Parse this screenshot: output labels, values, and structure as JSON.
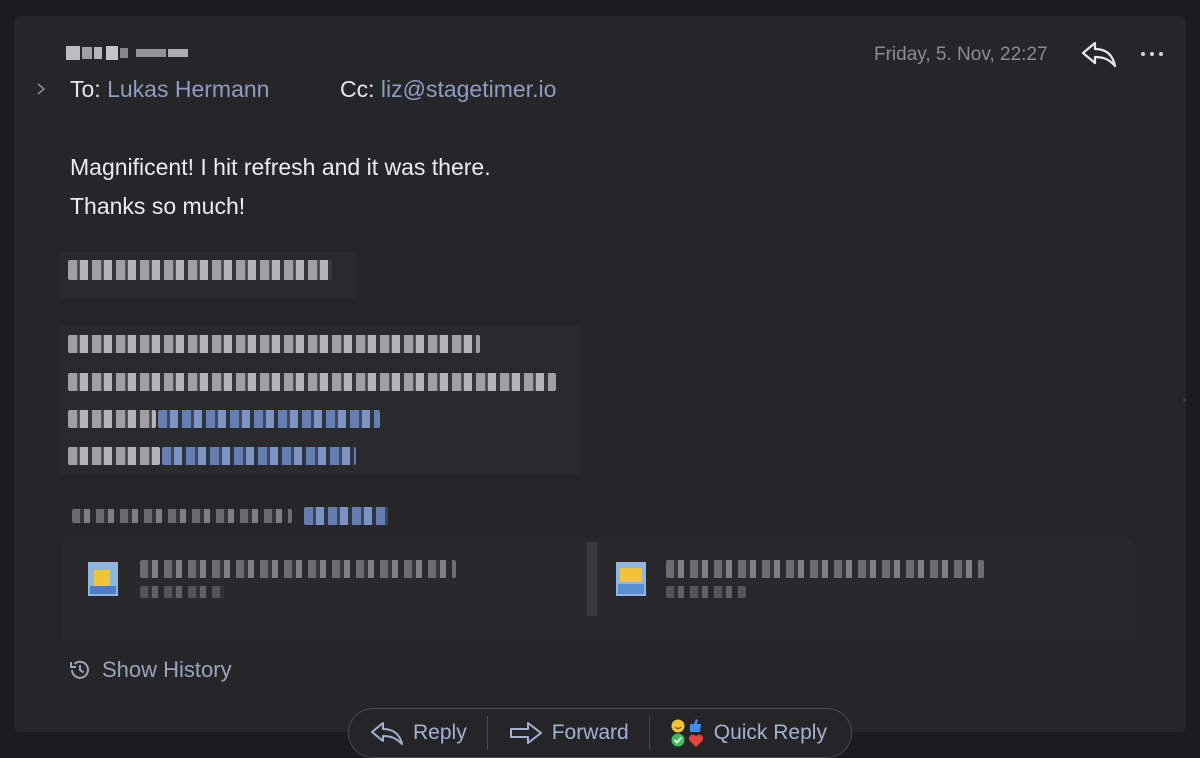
{
  "message": {
    "date": "Friday, 5. Nov, 22:27",
    "to_label": "To:",
    "to_name": "Lukas Hermann",
    "cc_label": "Cc:",
    "cc_address": "liz@stagetimer.io",
    "body_line1": "Magnificent! I hit refresh and it was there.",
    "body_line2": "Thanks so much!"
  },
  "history": {
    "label": "Show History"
  },
  "actions": {
    "reply": "Reply",
    "forward": "Forward",
    "quick_reply": "Quick Reply"
  },
  "colors": {
    "background": "#1c1c1e",
    "card": "#262628",
    "link": "#8f9dc4",
    "action_text": "#a5b1d3"
  }
}
